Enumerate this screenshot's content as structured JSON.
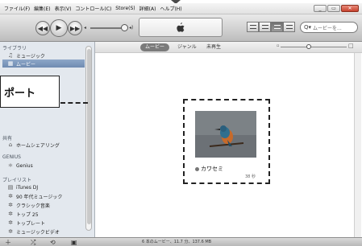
{
  "menubar": {
    "items": [
      "ファイル(F)",
      "編集(E)",
      "表示(V)",
      "コントロール(C)",
      "Store(S)",
      "詳細(A)",
      "ヘルプ(H)"
    ]
  },
  "search": {
    "placeholder": "ムービーを..."
  },
  "sidebar": {
    "library_heading": "ライブラリ",
    "library_items": [
      {
        "label": "ミュージック",
        "icon": "music-note-icon"
      },
      {
        "label": "ムービー",
        "icon": "film-icon"
      }
    ],
    "shared_heading": "共有",
    "shared_items": [
      {
        "label": "ホームシェアリング",
        "icon": "home-icon"
      }
    ],
    "genius_heading": "GENIUS",
    "genius_items": [
      {
        "label": "Genius",
        "icon": "genius-atom-icon"
      }
    ],
    "playlists_heading": "プレイリスト",
    "playlist_items": [
      {
        "label": "iTunes DJ",
        "icon": "dj-icon"
      },
      {
        "label": "90 年代ミュージック",
        "icon": "gear-playlist-icon"
      },
      {
        "label": "クラシック音楽",
        "icon": "gear-playlist-icon"
      },
      {
        "label": "トップ 25",
        "icon": "gear-playlist-icon"
      },
      {
        "label": "トップレート",
        "icon": "gear-playlist-icon"
      },
      {
        "label": "ミュージックビデオ",
        "icon": "gear-playlist-icon"
      }
    ]
  },
  "callout": {
    "label": "ポート"
  },
  "content": {
    "tabs": [
      "ムービー",
      "ジャンル",
      "未再生"
    ],
    "selected_tab": "ムービー"
  },
  "movie": {
    "title": "カワセミ",
    "duration": "38 秒"
  },
  "status": {
    "text": "6 本のムービー、11.7 分、137.6 MB"
  },
  "colors": {
    "selected": "#7d97bd",
    "sidebar_bg": "#e3e8ee",
    "callout_border": "#222222"
  }
}
